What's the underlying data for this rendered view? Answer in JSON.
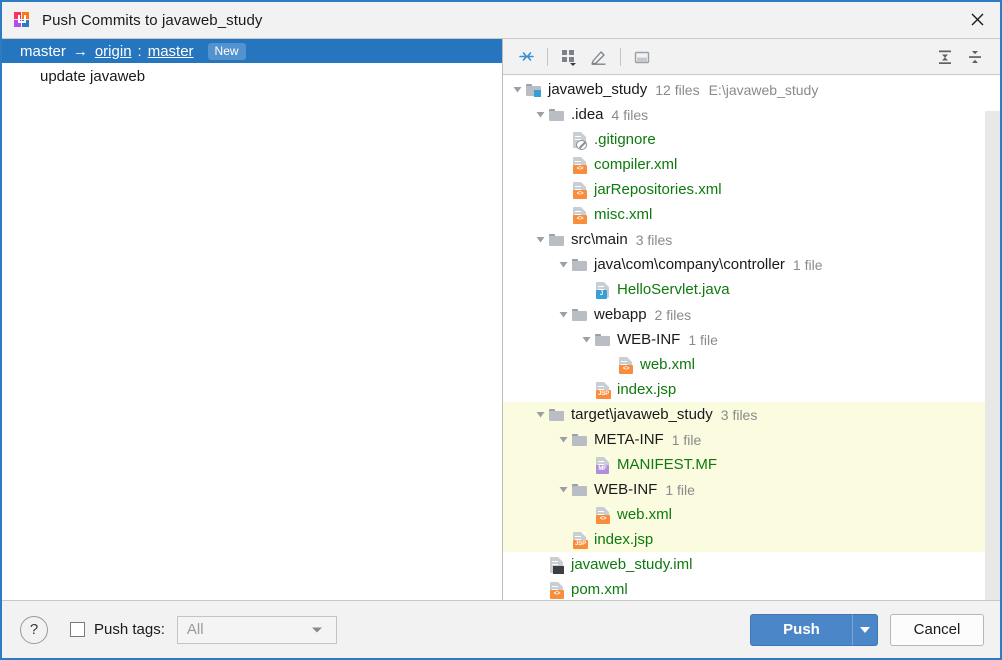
{
  "window": {
    "title": "Push Commits to javaweb_study",
    "app_icon": "intellij-idea-logo",
    "close_icon": "close-icon"
  },
  "commits_panel": {
    "branch": {
      "local": "master",
      "arrow": "→",
      "remote": "origin",
      "colon": ":",
      "remote_branch": "master",
      "badge": "New"
    },
    "commits": [
      {
        "message": "update javaweb"
      }
    ]
  },
  "files_panel": {
    "toolbar": {
      "left": [
        {
          "name": "collapse-selection-icon",
          "title": "Collapse"
        },
        {
          "name": "group-by-icon",
          "title": "Group By"
        },
        {
          "name": "edit-icon",
          "title": "Edit"
        },
        {
          "name": "preview-pane-icon",
          "title": "Preview"
        }
      ],
      "right": [
        {
          "name": "expand-all-icon",
          "title": "Expand All"
        },
        {
          "name": "collapse-all-icon",
          "title": "Collapse All"
        }
      ]
    },
    "tree": [
      {
        "indent": 0,
        "twisty": "down",
        "icon": "folder-module",
        "label": "javaweb_study",
        "type": "dir",
        "count": "12 files",
        "path": "E:\\javaweb_study",
        "highlight": false
      },
      {
        "indent": 1,
        "twisty": "down",
        "icon": "folder",
        "label": ".idea",
        "type": "dir",
        "count": "4 files",
        "path": "",
        "highlight": false
      },
      {
        "indent": 2,
        "twisty": "none",
        "icon": "file-ignore",
        "label": ".gitignore",
        "type": "file",
        "count": "",
        "path": "",
        "highlight": false
      },
      {
        "indent": 2,
        "twisty": "none",
        "icon": "file-xml",
        "label": "compiler.xml",
        "type": "file",
        "count": "",
        "path": "",
        "highlight": false
      },
      {
        "indent": 2,
        "twisty": "none",
        "icon": "file-xml",
        "label": "jarRepositories.xml",
        "type": "file",
        "count": "",
        "path": "",
        "highlight": false
      },
      {
        "indent": 2,
        "twisty": "none",
        "icon": "file-xml",
        "label": "misc.xml",
        "type": "file",
        "count": "",
        "path": "",
        "highlight": false
      },
      {
        "indent": 1,
        "twisty": "down",
        "icon": "folder",
        "label": "src\\main",
        "type": "dir",
        "count": "3 files",
        "path": "",
        "highlight": false
      },
      {
        "indent": 2,
        "twisty": "down",
        "icon": "folder",
        "label": "java\\com\\company\\controller",
        "type": "dir",
        "count": "1 file",
        "path": "",
        "highlight": false
      },
      {
        "indent": 3,
        "twisty": "none",
        "icon": "file-java",
        "label": "HelloServlet.java",
        "type": "file",
        "count": "",
        "path": "",
        "highlight": false
      },
      {
        "indent": 2,
        "twisty": "down",
        "icon": "folder",
        "label": "webapp",
        "type": "dir",
        "count": "2 files",
        "path": "",
        "highlight": false
      },
      {
        "indent": 3,
        "twisty": "down",
        "icon": "folder",
        "label": "WEB-INF",
        "type": "dir",
        "count": "1 file",
        "path": "",
        "highlight": false
      },
      {
        "indent": 4,
        "twisty": "none",
        "icon": "file-xml",
        "label": "web.xml",
        "type": "file",
        "count": "",
        "path": "",
        "highlight": false
      },
      {
        "indent": 3,
        "twisty": "none",
        "icon": "file-jsp",
        "label": "index.jsp",
        "type": "file",
        "count": "",
        "path": "",
        "highlight": false
      },
      {
        "indent": 1,
        "twisty": "down",
        "icon": "folder",
        "label": "target\\javaweb_study",
        "type": "dir",
        "count": "3 files",
        "path": "",
        "highlight": true
      },
      {
        "indent": 2,
        "twisty": "down",
        "icon": "folder",
        "label": "META-INF",
        "type": "dir",
        "count": "1 file",
        "path": "",
        "highlight": true
      },
      {
        "indent": 3,
        "twisty": "none",
        "icon": "file-mf",
        "label": "MANIFEST.MF",
        "type": "file",
        "count": "",
        "path": "",
        "highlight": true
      },
      {
        "indent": 2,
        "twisty": "down",
        "icon": "folder",
        "label": "WEB-INF",
        "type": "dir",
        "count": "1 file",
        "path": "",
        "highlight": true
      },
      {
        "indent": 3,
        "twisty": "none",
        "icon": "file-xml",
        "label": "web.xml",
        "type": "file",
        "count": "",
        "path": "",
        "highlight": true
      },
      {
        "indent": 2,
        "twisty": "none",
        "icon": "file-jsp",
        "label": "index.jsp",
        "type": "file",
        "count": "",
        "path": "",
        "highlight": true
      },
      {
        "indent": 1,
        "twisty": "none",
        "icon": "file-iml",
        "label": "javaweb_study.iml",
        "type": "file",
        "count": "",
        "path": "",
        "highlight": false
      },
      {
        "indent": 1,
        "twisty": "none",
        "icon": "file-xml",
        "label": "pom.xml",
        "type": "file",
        "count": "",
        "path": "",
        "highlight": false
      }
    ]
  },
  "bottom_bar": {
    "help_label": "?",
    "push_tags_label": "Push tags:",
    "push_tags_checked": false,
    "tags_value": "All",
    "push_label": "Push",
    "cancel_label": "Cancel"
  },
  "colors": {
    "selection_blue": "#2675bf",
    "badge_blue": "#5292cf",
    "button_blue": "#4a86c8",
    "highlight_yellow": "#fbfbe0",
    "file_green": "#0e7a0e",
    "border_blue": "#2d7bc4"
  }
}
